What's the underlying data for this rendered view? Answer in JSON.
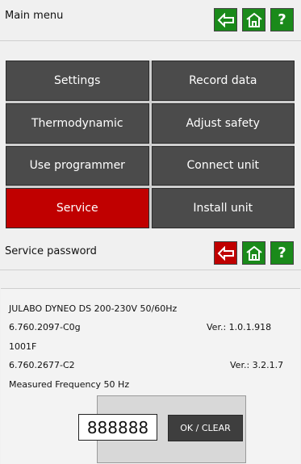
{
  "top_header": {
    "title": "Main menu"
  },
  "menu": {
    "items": [
      {
        "label": "Settings"
      },
      {
        "label": "Record data"
      },
      {
        "label": "Thermodynamic"
      },
      {
        "label": "Adjust safety"
      },
      {
        "label": "Use programmer"
      },
      {
        "label": "Connect unit"
      },
      {
        "label": "Service"
      },
      {
        "label": "Install unit"
      }
    ]
  },
  "service_header": {
    "title": "Service password"
  },
  "info": {
    "model": "JULABO DYNEO DS 200-230V 50/60Hz",
    "part1": "6.760.2097-C0g",
    "ver1": "Ver.: 1.0.1.918",
    "code": "1001F",
    "part2": "6.760.2677-C2",
    "ver2": "Ver.: 3.2.1.7",
    "freq": "Measured Frequency 50 Hz"
  },
  "password": {
    "value": "888888",
    "ok_label": "OK / CLEAR"
  },
  "colors": {
    "green": "#1a8a1a",
    "red": "#c00000",
    "tile": "#4b4b4b"
  },
  "help_symbol": "?"
}
